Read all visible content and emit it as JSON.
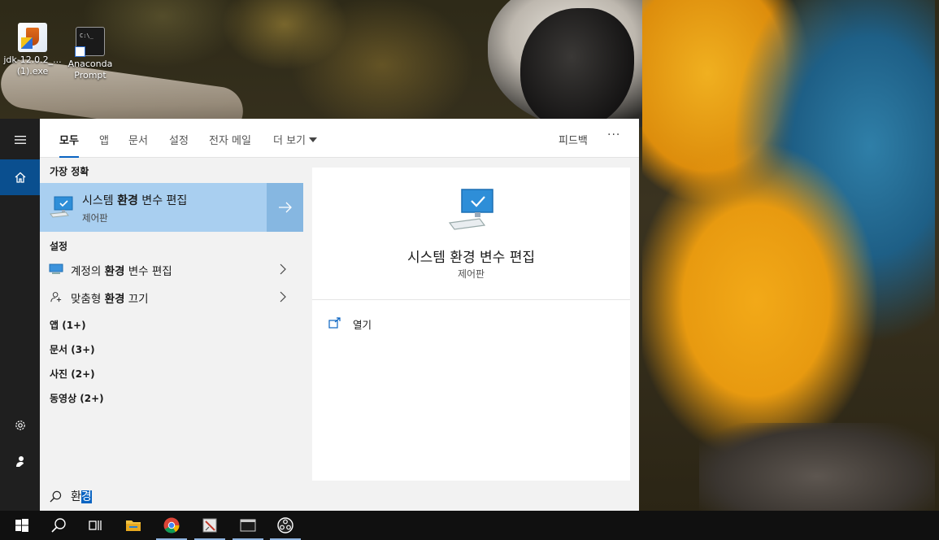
{
  "desktop": {
    "icons": [
      {
        "label_line1": "jdk-12.0.2_...",
        "label_line2": "(1).exe",
        "icon": "java-installer-icon"
      },
      {
        "label_line1": "Anaconda",
        "label_line2": "Prompt",
        "icon": "command-prompt-shortcut-icon"
      }
    ]
  },
  "start_rail": {
    "menu_icon": "hamburger-icon",
    "home_icon": "home-icon",
    "settings_icon": "gear-icon",
    "user_icon": "user-icon"
  },
  "tabs": {
    "items": [
      {
        "label": "모두",
        "active": true
      },
      {
        "label": "앱",
        "active": false
      },
      {
        "label": "문서",
        "active": false
      },
      {
        "label": "설정",
        "active": false
      },
      {
        "label": "전자 메일",
        "active": false
      },
      {
        "label": "더 보기",
        "active": false
      }
    ],
    "feedback": "피드백",
    "more_options": "···"
  },
  "results": {
    "best_match_header": "가장 정확",
    "best_match": {
      "title_pre": "시스템 ",
      "title_bold": "환경",
      "title_post": " 변수 편집",
      "subtitle": "제어판"
    },
    "settings_header": "설정",
    "settings_items": [
      {
        "pre": "계정의 ",
        "bold": "환경",
        "post": " 변수 편집",
        "icon": "monitor-icon"
      },
      {
        "pre": "맞춤형 ",
        "bold": "환경",
        "post": " 끄기",
        "icon": "person-sparkle-icon"
      }
    ],
    "categories": [
      "앱 (1+)",
      "문서 (3+)",
      "사진 (2+)",
      "동영상 (2+)"
    ]
  },
  "preview": {
    "title": "시스템 환경 변수 편집",
    "subtitle": "제어판",
    "action_label": "열기"
  },
  "search": {
    "query_unselected": "환",
    "query_selected": "경"
  },
  "taskbar": {
    "items": [
      "windows-start-icon",
      "search-icon",
      "task-view-icon",
      "file-explorer-icon",
      "chrome-icon",
      "paint-app-icon",
      "terminal-icon",
      "obs-icon"
    ]
  },
  "colors": {
    "accent": "#0a64c2",
    "best_match_bg": "#a9cff0",
    "rail_bg": "#1f1f1f",
    "taskbar_bg": "#101010"
  }
}
